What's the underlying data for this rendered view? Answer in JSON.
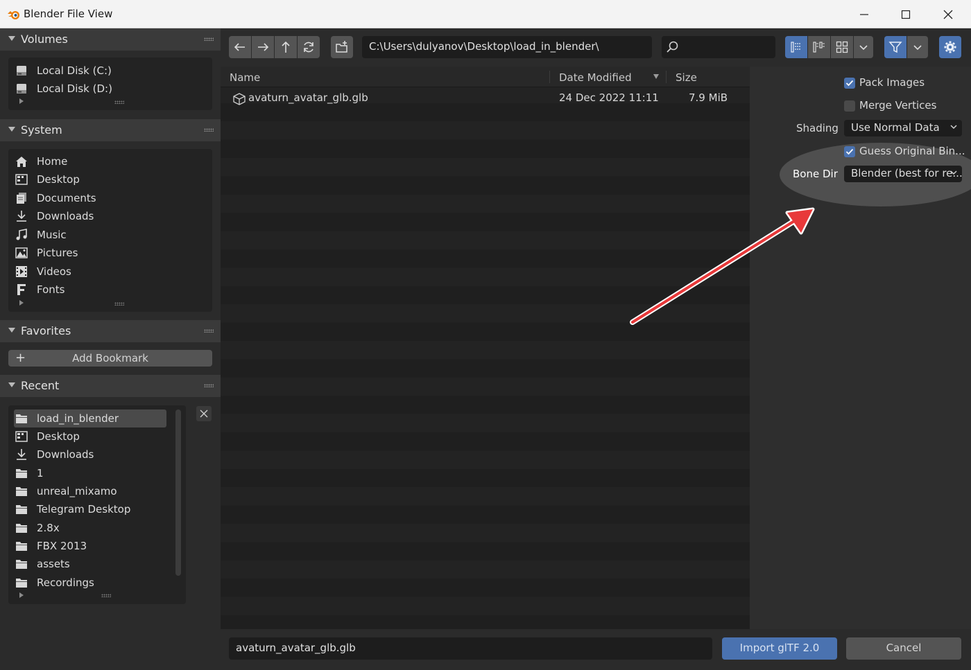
{
  "window": {
    "title": "Blender File View"
  },
  "sidebar": {
    "volumes": {
      "title": "Volumes",
      "items": [
        {
          "label": "Local Disk (C:)",
          "icon": "disk-icon"
        },
        {
          "label": "Local Disk (D:)",
          "icon": "disk-icon"
        }
      ]
    },
    "system": {
      "title": "System",
      "items": [
        {
          "label": "Home",
          "icon": "home-icon"
        },
        {
          "label": "Desktop",
          "icon": "desktop-icon"
        },
        {
          "label": "Documents",
          "icon": "documents-icon"
        },
        {
          "label": "Downloads",
          "icon": "downloads-icon"
        },
        {
          "label": "Music",
          "icon": "music-icon"
        },
        {
          "label": "Pictures",
          "icon": "pictures-icon"
        },
        {
          "label": "Videos",
          "icon": "videos-icon"
        },
        {
          "label": "Fonts",
          "icon": "fonts-icon"
        }
      ]
    },
    "favorites": {
      "title": "Favorites",
      "add_bookmark": "Add Bookmark"
    },
    "recent": {
      "title": "Recent",
      "items": [
        {
          "label": "load_in_blender",
          "icon": "folder-icon",
          "selected": true
        },
        {
          "label": "Desktop",
          "icon": "desktop-icon"
        },
        {
          "label": "Downloads",
          "icon": "downloads-icon"
        },
        {
          "label": "1",
          "icon": "folder-icon"
        },
        {
          "label": "unreal_mixamo",
          "icon": "folder-icon"
        },
        {
          "label": "Telegram Desktop",
          "icon": "folder-icon"
        },
        {
          "label": "2.8x",
          "icon": "folder-icon"
        },
        {
          "label": "FBX 2013",
          "icon": "folder-icon"
        },
        {
          "label": "assets",
          "icon": "folder-icon"
        },
        {
          "label": "Recordings",
          "icon": "folder-icon"
        }
      ]
    }
  },
  "toolbar": {
    "path": "C:\\Users\\dulyanov\\Desktop\\load_in_blender\\",
    "search_value": ""
  },
  "filelist": {
    "columns": {
      "name": "Name",
      "date": "Date Modified",
      "size": "Size"
    },
    "files": [
      {
        "name": "avaturn_avatar_glb.glb",
        "date": "24 Dec 2022 11:11",
        "size": "7.9 MiB",
        "icon": "mesh-cube-icon"
      }
    ]
  },
  "options": {
    "pack_images": {
      "label": "Pack Images",
      "checked": true
    },
    "merge_vertices": {
      "label": "Merge Vertices",
      "checked": false
    },
    "shading": {
      "label": "Shading",
      "value": "Use Normal Data"
    },
    "guess_bind": {
      "label": "Guess Original Bin...",
      "checked": true
    },
    "bone_dir": {
      "label": "Bone Dir",
      "value": "Blender (best for re..."
    }
  },
  "footer": {
    "filename": "avaturn_avatar_glb.glb",
    "import_label": "Import glTF 2.0",
    "cancel_label": "Cancel"
  },
  "colors": {
    "accent": "#4a72b0",
    "annotation_arrow": "#e8393a"
  }
}
